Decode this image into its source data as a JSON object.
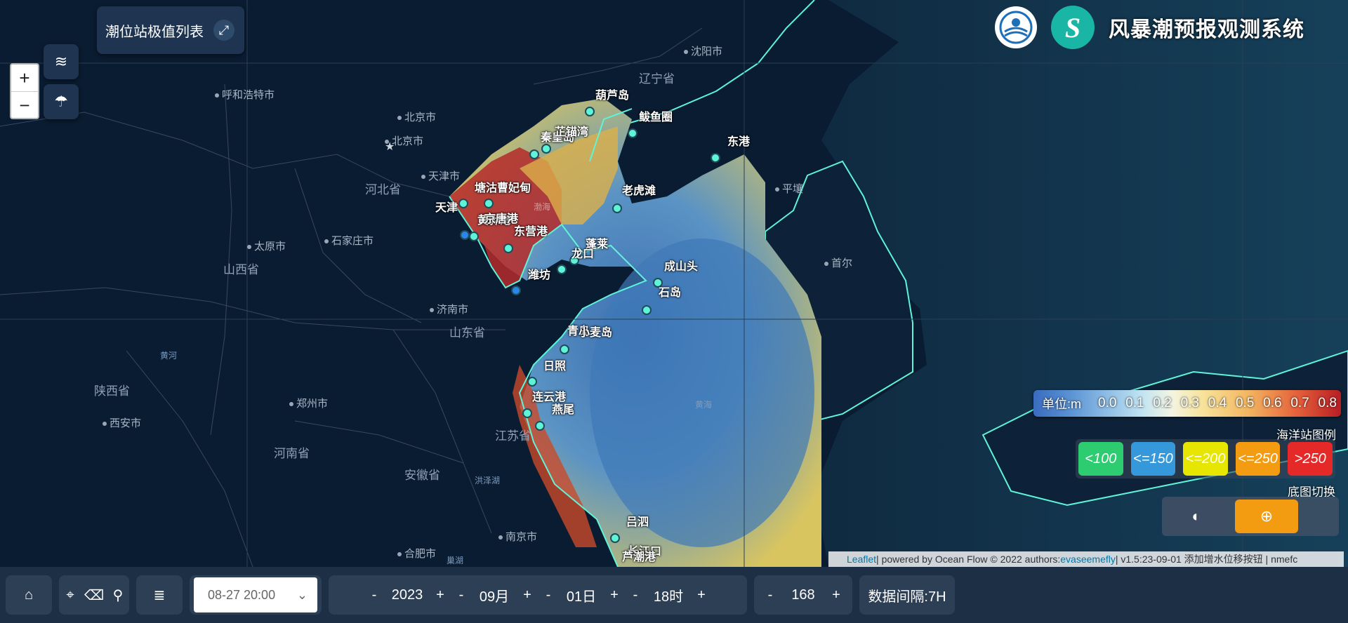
{
  "header": {
    "title": "风暴潮预报观测系统"
  },
  "tide_list": {
    "label": "潮位站极值列表"
  },
  "zoom": {
    "in": "+",
    "out": "−"
  },
  "provinces": [
    "辽宁省",
    "河北省",
    "山西省",
    "山东省",
    "陕西省",
    "河南省",
    "江苏省",
    "安徽省"
  ],
  "cities": [
    "沈阳市",
    "呼和浩特市",
    "北京市",
    "北京市",
    "天津市",
    "石家庄市",
    "太原市",
    "济南市",
    "郑州市",
    "西安市",
    "合肥市",
    "南京市",
    "平壤",
    "首尔"
  ],
  "water_labels": [
    "渤海",
    "黄海",
    "黄河",
    "洪泽湖",
    "巢湖"
  ],
  "stations": [
    "葫芦岛",
    "鲅鱼圈",
    "秦皇岛",
    "芷锚湾",
    "东港",
    "塘沽",
    "曹妃甸",
    "老虎滩",
    "天津",
    "黄骅港",
    "京唐港",
    "东营港",
    "蓬莱",
    "龙口",
    "潍坊",
    "成山头",
    "石岛",
    "青岛",
    "小麦岛",
    "日照",
    "连云港",
    "燕尾",
    "吕泗",
    "长江口",
    "芦潮港"
  ],
  "legend": {
    "unit": "单位:m",
    "ticks": [
      "0.0",
      "0.1",
      "0.2",
      "0.3",
      "0.4",
      "0.5",
      "0.6",
      "0.7",
      "0.8"
    ],
    "station_title": "海洋站图例",
    "station_levels": [
      {
        "label": "<100",
        "color": "#2ecc71"
      },
      {
        "label": "<=150",
        "color": "#3498db"
      },
      {
        "label": "<=200",
        "color": "#e6e600"
      },
      {
        "label": "<=250",
        "color": "#f39c12"
      },
      {
        "label": ">250",
        "color": "#e52828"
      }
    ],
    "basemap_title": "底图切换"
  },
  "attribution": {
    "leaflet": "Leaflet",
    "text1": " | powered by Ocean Flow © 2022 authors: ",
    "author": "evaseemefly",
    "text2": " | v1.5:23-09-01 添加增水位移按钮 | nmefc"
  },
  "bottom": {
    "datetime": "08-27 20:00",
    "year": "2023",
    "month": "09月",
    "day": "01日",
    "hour": "18时",
    "forecast": "168",
    "interval": "数据间隔:7H",
    "minus": "-",
    "plus": "+"
  },
  "colors": {
    "accent": "#f39c12",
    "coast": "#5ff3d8",
    "sea": "#0b1d33"
  }
}
